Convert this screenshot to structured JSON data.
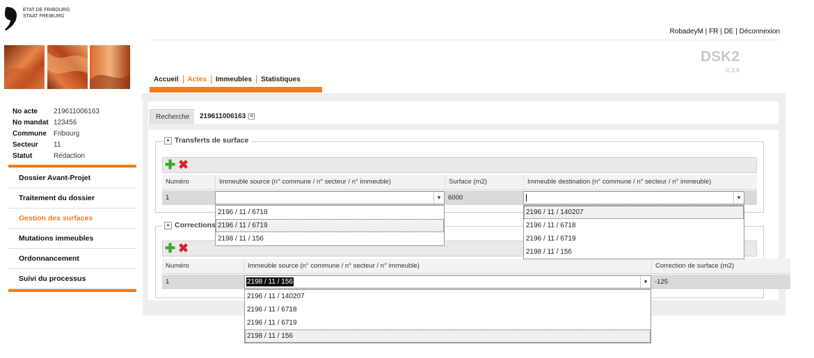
{
  "header": {
    "logo_line1": "ETAT DE FRIBOURG",
    "logo_line2": "STAAT FREIBURG",
    "user": "RobadeyM",
    "lang_fr": "FR",
    "lang_de": "DE",
    "logout": "Déconnexion",
    "app_name": "DSK2",
    "app_version": "0.3.8"
  },
  "nav": {
    "items": [
      {
        "label": "Accueil"
      },
      {
        "label": "Actes"
      },
      {
        "label": "Immeubles"
      },
      {
        "label": "Statistiques"
      }
    ],
    "active": "Actes"
  },
  "info": {
    "no_acte_label": "No acte",
    "no_acte": "219611006163",
    "no_mandat_label": "No mandat",
    "no_mandat": "123456",
    "commune_label": "Commune",
    "commune": "Fribourg",
    "secteur_label": "Secteur",
    "secteur": "11",
    "statut_label": "Statut",
    "statut": "Rédaction"
  },
  "menu": {
    "items": [
      {
        "label": "Dossier Avant-Projet"
      },
      {
        "label": "Traitement du dossier"
      },
      {
        "label": "Gestion des surfaces"
      },
      {
        "label": "Mutations immeubles"
      },
      {
        "label": "Ordonnancement"
      },
      {
        "label": "Suivi du processus"
      }
    ],
    "active": "Gestion des surfaces"
  },
  "tabs": {
    "search": "Recherche",
    "current": "219611006163",
    "close_glyph": "✕"
  },
  "transferts": {
    "legend": "Transferts de surface",
    "columns": {
      "numero": "Numéro",
      "source": "Immeuble source (n° commune / n° secteur / n° immeuble)",
      "surface": "Surface (m2)",
      "destination": "Immeuble destination (n° commune / n° secteur / n° immeuble)"
    },
    "row": {
      "numero": "1",
      "source": "",
      "surface": "6000",
      "destination": ""
    },
    "source_options": [
      "2196 / 11 / 6718",
      "2196 / 11 / 6719",
      "2198 / 11 / 156"
    ],
    "destination_options": [
      "2196 / 11 / 140207",
      "2196 / 11 / 6718",
      "2196 / 11 / 6719",
      "2198 / 11 / 156"
    ]
  },
  "corrections": {
    "legend": "Corrections",
    "columns": {
      "numero": "Numéro",
      "source": "Immeuble source (n° commune / n° secteur / n° immeuble)",
      "correction": "Correction de surface (m2)"
    },
    "row": {
      "numero": "1",
      "source": "2198 / 11 / 156",
      "correction": "-125"
    },
    "source_options": [
      "2196 / 11 / 140207",
      "2196 / 11 / 6718",
      "2196 / 11 / 6719",
      "2198 / 11 / 156"
    ]
  },
  "colors": {
    "accent": "#f07d1a",
    "add": "#3aa626",
    "delete": "#d9242a"
  },
  "icons": {
    "add": "plus-icon",
    "delete": "cross-icon",
    "caret": "▾",
    "toggle": "▲"
  }
}
